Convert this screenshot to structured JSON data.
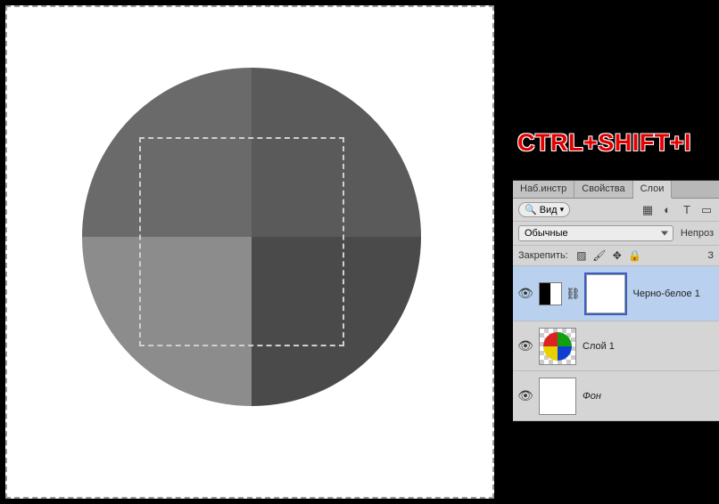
{
  "annotation": "CTRL+SHIFT+I",
  "tabs": {
    "presets": "Наб.инстр",
    "properties": "Свойства",
    "layers": "Слои"
  },
  "filter": {
    "label": "Вид",
    "search_icon": "search"
  },
  "blend": {
    "mode": "Обычные",
    "opacity_label": "Непроз"
  },
  "lock": {
    "label": "Закрепить:",
    "fill_label": "З"
  },
  "layer_list": [
    {
      "name": "Черно-белое 1",
      "type": "adjustment",
      "visible": true,
      "selected": true
    },
    {
      "name": "Слой 1",
      "type": "image",
      "visible": true,
      "selected": false
    },
    {
      "name": "Фон",
      "type": "background",
      "visible": true,
      "selected": false
    }
  ],
  "icons": {
    "image": "image-icon",
    "adjust": "adjust-icon",
    "type": "type-icon",
    "shape": "shape-icon"
  }
}
